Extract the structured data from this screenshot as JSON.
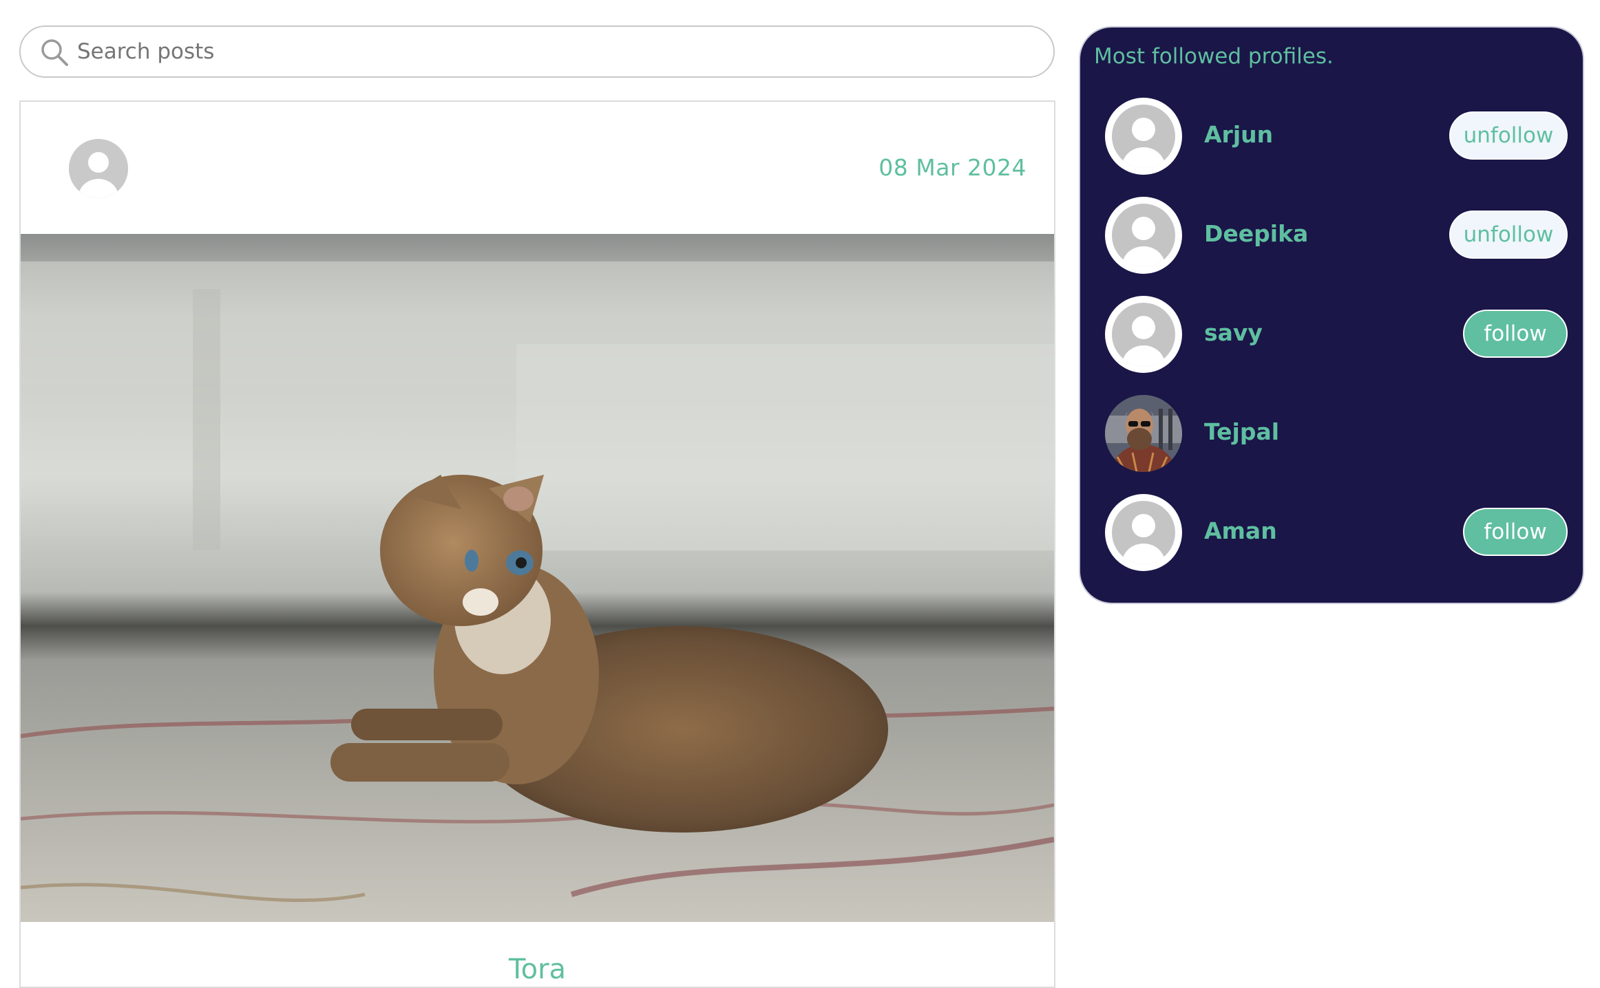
{
  "search": {
    "placeholder": "Search posts"
  },
  "post": {
    "date": "08 Mar 2024",
    "title": "Tora",
    "image_alt": "cat-photo"
  },
  "sidebar": {
    "title": "Most followed profiles.",
    "profiles": [
      {
        "name": "Arjun",
        "action": "unfollow"
      },
      {
        "name": "Deepika",
        "action": "unfollow"
      },
      {
        "name": "savy",
        "action": "follow"
      },
      {
        "name": "Tejpal",
        "action": ""
      },
      {
        "name": "Aman",
        "action": "follow"
      }
    ]
  },
  "colors": {
    "accent": "#5fbfa0",
    "sidebar_bg": "#1a1648",
    "unfollow_bg": "#f0f6fb"
  }
}
